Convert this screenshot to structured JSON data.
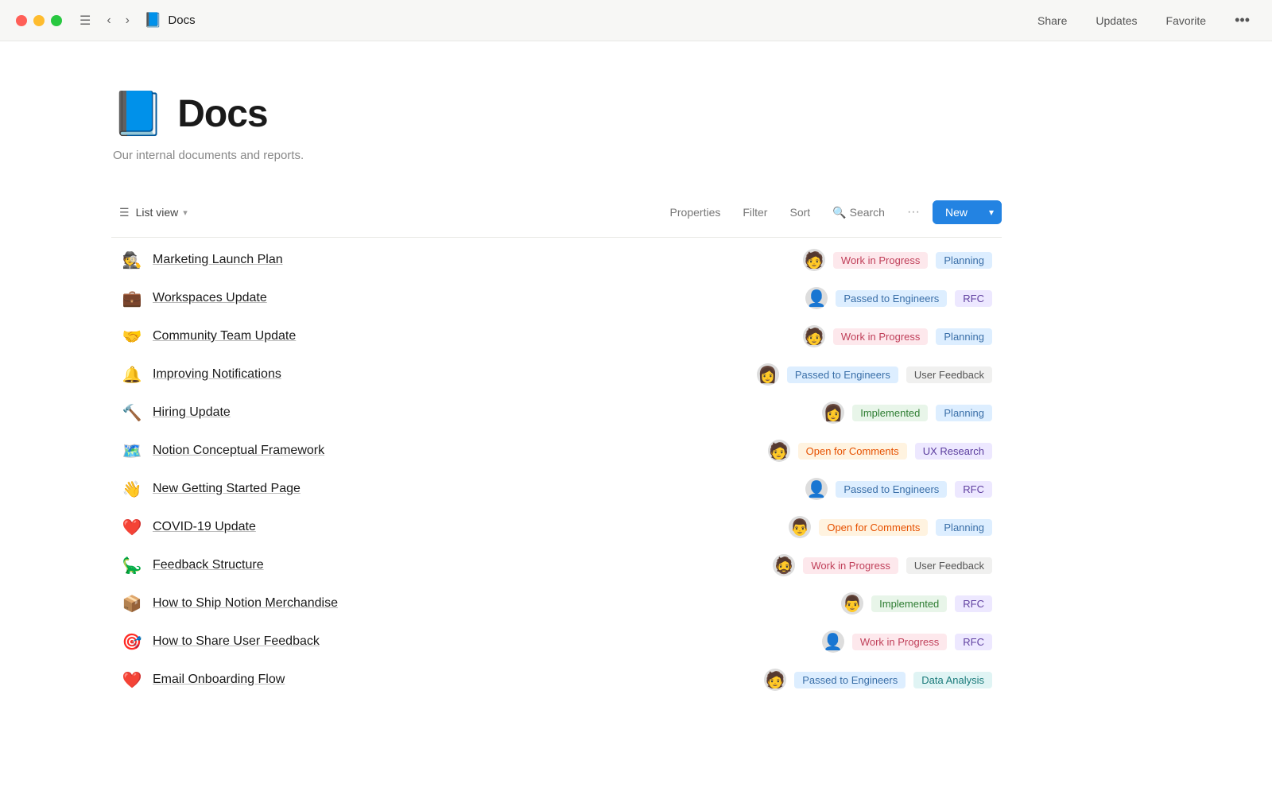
{
  "titlebar": {
    "title": "Docs",
    "emoji": "📘",
    "actions": [
      "Share",
      "Updates",
      "Favorite"
    ]
  },
  "page": {
    "emoji": "📘",
    "title": "Docs",
    "subtitle": "Our internal documents and reports."
  },
  "toolbar": {
    "view_label": "List view",
    "properties": "Properties",
    "filter": "Filter",
    "sort": "Sort",
    "search": "Search",
    "more": "···",
    "new": "New"
  },
  "items": [
    {
      "emoji": "🕵️",
      "title": "Marketing Launch Plan",
      "avatar": "🧑",
      "status": "Work in Progress",
      "status_class": "badge-pink",
      "tag": "Planning",
      "tag_class": "badge-blue"
    },
    {
      "emoji": "💼",
      "title": "Workspaces Update",
      "avatar": "👤",
      "status": "Passed to Engineers",
      "status_class": "badge-blue",
      "tag": "RFC",
      "tag_class": "badge-purple"
    },
    {
      "emoji": "🤝",
      "title": "Community Team Update",
      "avatar": "🧑",
      "status": "Work in Progress",
      "status_class": "badge-pink",
      "tag": "Planning",
      "tag_class": "badge-blue"
    },
    {
      "emoji": "🔔",
      "title": "Improving Notifications",
      "avatar": "👩",
      "status": "Passed to Engineers",
      "status_class": "badge-blue",
      "tag": "User Feedback",
      "tag_class": "badge-gray"
    },
    {
      "emoji": "🔨",
      "title": "Hiring Update",
      "avatar": "👩",
      "status": "Implemented",
      "status_class": "badge-green",
      "tag": "Planning",
      "tag_class": "badge-blue"
    },
    {
      "emoji": "🗺️",
      "title": "Notion Conceptual Framework",
      "avatar": "🧑",
      "status": "Open for Comments",
      "status_class": "badge-orange",
      "tag": "UX Research",
      "tag_class": "badge-lavender"
    },
    {
      "emoji": "👋",
      "title": "New Getting Started Page",
      "avatar": "👤",
      "status": "Passed to Engineers",
      "status_class": "badge-blue",
      "tag": "RFC",
      "tag_class": "badge-purple"
    },
    {
      "emoji": "❤️",
      "title": "COVID-19 Update",
      "avatar": "👨",
      "status": "Open for Comments",
      "status_class": "badge-orange",
      "tag": "Planning",
      "tag_class": "badge-blue"
    },
    {
      "emoji": "🦕",
      "title": "Feedback Structure",
      "avatar": "🧔",
      "status": "Work in Progress",
      "status_class": "badge-pink",
      "tag": "User Feedback",
      "tag_class": "badge-gray"
    },
    {
      "emoji": "📦",
      "title": "How to Ship Notion Merchandise",
      "avatar": "👨",
      "status": "Implemented",
      "status_class": "badge-green",
      "tag": "RFC",
      "tag_class": "badge-purple"
    },
    {
      "emoji": "🎯",
      "title": "How to Share User Feedback",
      "avatar": "👤",
      "status": "Work in Progress",
      "status_class": "badge-pink",
      "tag": "RFC",
      "tag_class": "badge-purple"
    },
    {
      "emoji": "❤️",
      "title": "Email Onboarding Flow",
      "avatar": "🧑",
      "status": "Passed to Engineers",
      "status_class": "badge-blue",
      "tag": "Data Analysis",
      "tag_class": "badge-teal"
    }
  ]
}
